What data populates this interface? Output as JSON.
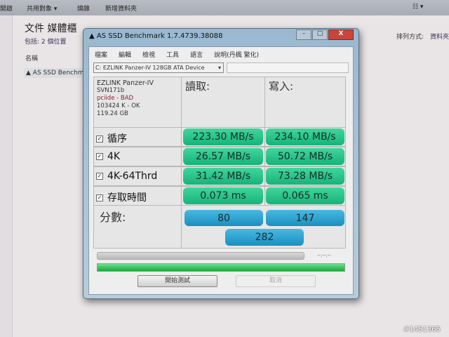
{
  "explorer": {
    "toolbar": [
      "開啟",
      "共用對象 ▾",
      "燒錄",
      "新增資料夾"
    ],
    "library_title": "文件 媒體櫃",
    "includes": "包括: 2 個位置",
    "sort_label": "排列方式:",
    "sort_value": "資料夾",
    "column_name": "名稱",
    "file_item": "AS SSD Benchm"
  },
  "window": {
    "title": "AS SSD Benchmark 1.7.4739.38088",
    "menu": [
      "檔案",
      "編輯",
      "檢視",
      "工具",
      "語言",
      "說明(丹楓 繁化)"
    ],
    "drive_select": "C: EZLINK Panzer-IV 128GB ATA Device",
    "info": {
      "model": "EZLINK Panzer-IV",
      "firmware": "SVN171b",
      "driver": "pciide - BAD",
      "alignment": "103424 K - OK",
      "size": "119.24 GB"
    },
    "headers": {
      "read": "讀取:",
      "write": "寫入:"
    },
    "rows": [
      {
        "label": "循序",
        "read": "223.30 MB/s",
        "write": "234.10 MB/s"
      },
      {
        "label": "4K",
        "read": "26.57 MB/s",
        "write": "50.72 MB/s"
      },
      {
        "label": "4K-64Thrd",
        "read": "31.42 MB/s",
        "write": "73.28 MB/s"
      },
      {
        "label": "存取時間",
        "read": "0.073 ms",
        "write": "0.065 ms"
      }
    ],
    "score": {
      "label": "分數:",
      "read": "80",
      "write": "147",
      "total": "282"
    },
    "elapsed": "--:--:--",
    "progress_percent": 100,
    "start_button": "開始測試",
    "cancel_button": "取消"
  },
  "watermark": "#1451365"
}
